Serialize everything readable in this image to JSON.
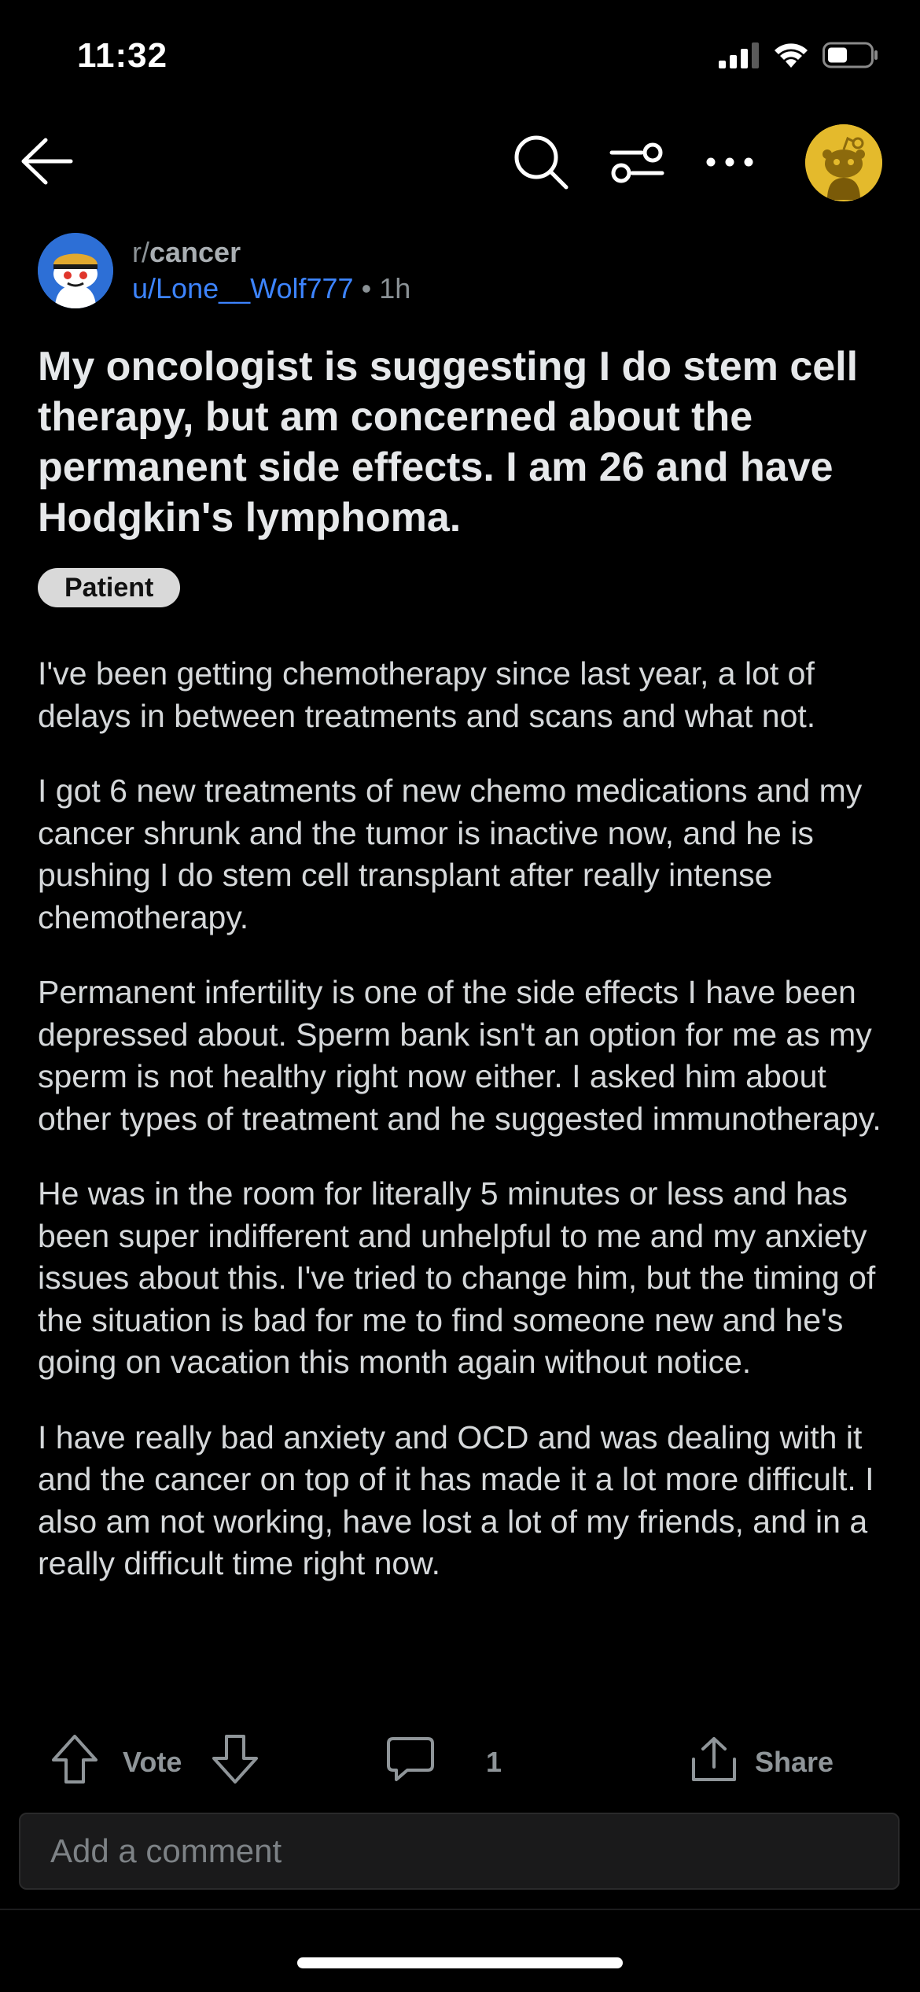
{
  "status_bar": {
    "time": "11:32",
    "icons": [
      "cellular-signal-icon",
      "wifi-icon",
      "battery-icon"
    ]
  },
  "nav": {
    "icons": [
      "back-arrow-icon",
      "search-icon",
      "filter-icon",
      "more-icon",
      "user-avatar"
    ]
  },
  "post": {
    "subreddit_prefix": "r/",
    "subreddit": "cancer",
    "author": "u/Lone__Wolf777",
    "separator": "•",
    "age": "1h",
    "title": "My oncologist is suggesting I do stem cell therapy, but am concerned about the permanent side effects. I am 26 and have Hodgkin's lymphoma.",
    "flair": "Patient",
    "paragraphs": [
      "I've been getting chemotherapy since last year, a lot of delays in between treatments and scans and what not.",
      "I got 6 new treatments of new chemo medications and my cancer shrunk and the tumor is inactive now, and he is pushing I do stem cell transplant after really intense chemotherapy.",
      "Permanent infertility is one of the side effects I have been depressed about. Sperm bank isn't an option for me as my sperm is not healthy right now either. I asked him about other types of treatment and he suggested immunotherapy.",
      "He was in the room for literally 5 minutes or less and has been super indifferent and unhelpful to me and my anxiety issues about this. I've tried to change him, but the timing of the situation is bad for me to find someone new and he's going on vacation this month again without notice.",
      "I have really bad anxiety and OCD and was dealing with it and the cancer on top of it has made it a lot more difficult. I also am not working, have lost a lot of my friends, and in a really difficult time right now."
    ]
  },
  "actions": {
    "vote_label": "Vote",
    "comment_count": "1",
    "share_label": "Share"
  },
  "comment_input": {
    "placeholder": "Add a comment"
  },
  "colors": {
    "background": "#000000",
    "author_link": "#3d84ff",
    "avatar_bg": "#e4ba2c",
    "flair_bg": "#d9d9d9"
  }
}
